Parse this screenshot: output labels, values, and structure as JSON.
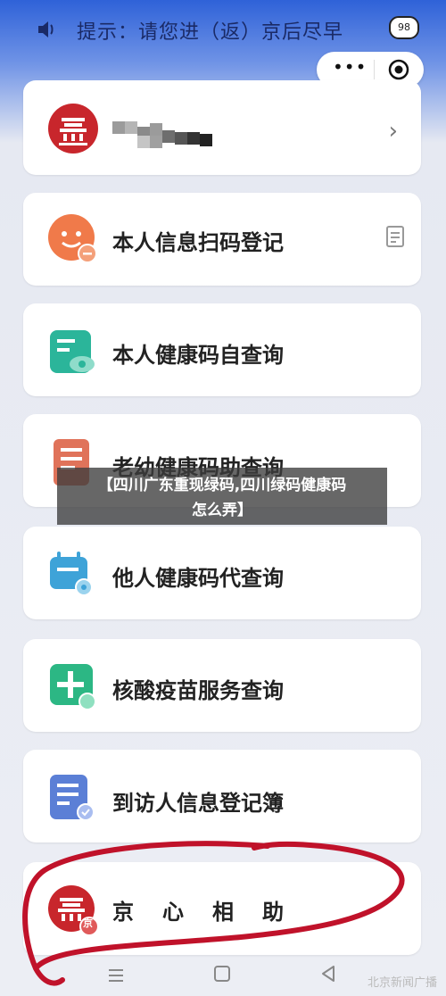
{
  "status_bar": {
    "notice": "提示：请您进（返）京后尽早",
    "battery": "98"
  },
  "capsule": {
    "more": "•••"
  },
  "cards": [
    {
      "label": "本人信息扫码登记"
    },
    {
      "label": "本人健康码自查询"
    },
    {
      "label": "老幼健康码助查询"
    },
    {
      "label": "他人健康码代查询"
    },
    {
      "label": "核酸疫苗服务查询"
    },
    {
      "label": "到访人信息登记簿"
    },
    {
      "label": "京　心　相　助"
    }
  ],
  "badges": {
    "beijing_small": "京"
  },
  "banner": {
    "line1": "【四川广东重现绿码,四川绿码健康码",
    "line2": "怎么弄】"
  },
  "watermark": "北京新闻广播",
  "colors": {
    "header_blue": "#2f62d8",
    "scribble_red": "#c0122a"
  }
}
